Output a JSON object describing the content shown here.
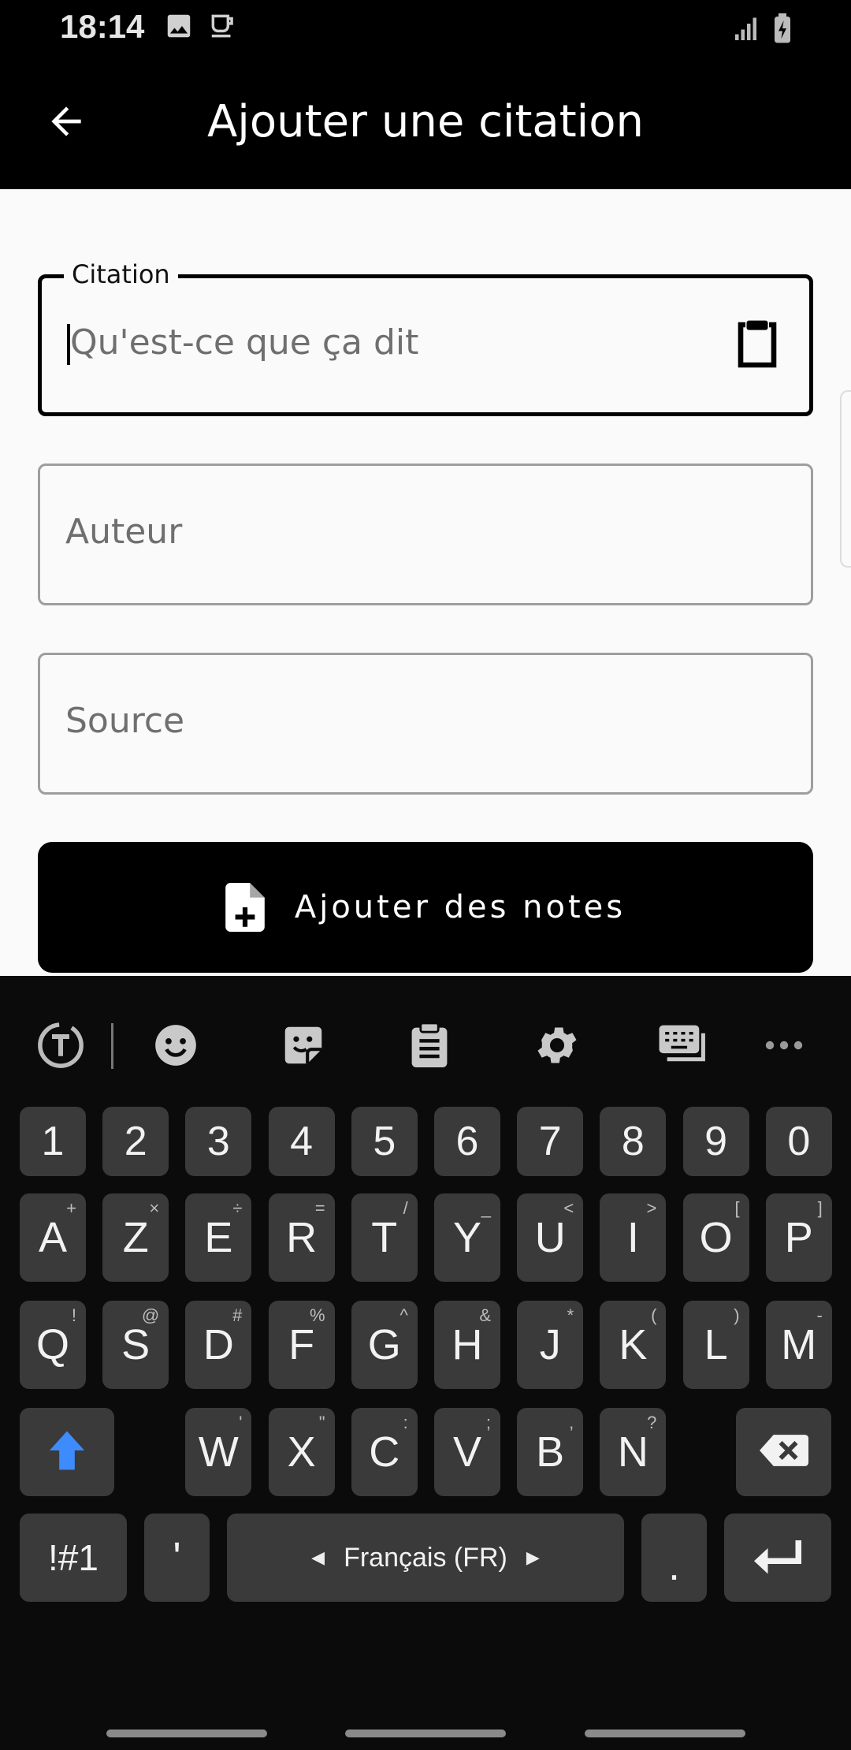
{
  "status_bar": {
    "time": "18:14",
    "icons_left": [
      "image-icon",
      "coffee-icon"
    ],
    "icons_right": [
      "signal-icon",
      "battery-charging-icon"
    ]
  },
  "app_bar": {
    "back_icon": "arrow-back-icon",
    "title": "Ajouter une citation"
  },
  "form": {
    "citation": {
      "label": "Citation",
      "placeholder": "Qu'est-ce que ça dit",
      "value": "",
      "action_icon": "clipboard-paste-icon"
    },
    "author": {
      "placeholder": "Auteur",
      "value": ""
    },
    "source": {
      "placeholder": "Source",
      "value": ""
    },
    "add_notes_button": {
      "label": "Ajouter des notes",
      "icon": "note-add-icon"
    }
  },
  "keyboard": {
    "toolbar": [
      "translate-icon",
      "emoji-icon",
      "sticker-icon",
      "clipboard-icon",
      "settings-icon",
      "keyboard-mode-icon",
      "more-icon"
    ],
    "number_row": [
      "1",
      "2",
      "3",
      "4",
      "5",
      "6",
      "7",
      "8",
      "9",
      "0"
    ],
    "row1": [
      {
        "key": "A",
        "sub": "+"
      },
      {
        "key": "Z",
        "sub": "×"
      },
      {
        "key": "E",
        "sub": "÷"
      },
      {
        "key": "R",
        "sub": "="
      },
      {
        "key": "T",
        "sub": "/"
      },
      {
        "key": "Y",
        "sub": "_"
      },
      {
        "key": "U",
        "sub": "<"
      },
      {
        "key": "I",
        "sub": ">"
      },
      {
        "key": "O",
        "sub": "["
      },
      {
        "key": "P",
        "sub": "]"
      }
    ],
    "row2": [
      {
        "key": "Q",
        "sub": "!"
      },
      {
        "key": "S",
        "sub": "@"
      },
      {
        "key": "D",
        "sub": "#"
      },
      {
        "key": "F",
        "sub": "%"
      },
      {
        "key": "G",
        "sub": "^"
      },
      {
        "key": "H",
        "sub": "&"
      },
      {
        "key": "J",
        "sub": "*"
      },
      {
        "key": "K",
        "sub": "("
      },
      {
        "key": "L",
        "sub": ")"
      },
      {
        "key": "M",
        "sub": "-"
      }
    ],
    "row3": [
      {
        "key": "W",
        "sub": "'"
      },
      {
        "key": "X",
        "sub": "\""
      },
      {
        "key": "C",
        "sub": ":"
      },
      {
        "key": "V",
        "sub": ";"
      },
      {
        "key": "B",
        "sub": ","
      },
      {
        "key": "N",
        "sub": "?"
      }
    ],
    "symbols_key": "!#1",
    "apostrophe_key": "'",
    "space_label": "Français (FR)",
    "period_key": ".",
    "shift_icon": "shift-arrow-icon",
    "backspace_icon": "backspace-icon",
    "enter_icon": "enter-icon",
    "colors": {
      "shift": "#3d8bfd",
      "key_bg": "#3a3a3a",
      "keyboard_bg": "#0b0b0b"
    }
  }
}
